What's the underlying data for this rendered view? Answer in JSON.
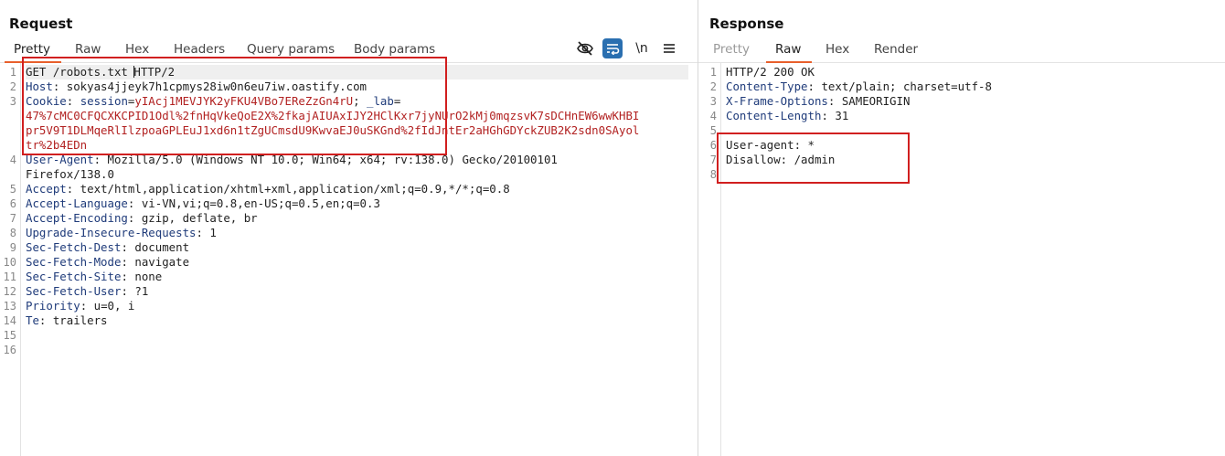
{
  "request": {
    "title": "Request",
    "tabs": [
      {
        "label": "Pretty",
        "active": true
      },
      {
        "label": "Raw"
      },
      {
        "label": "Hex"
      },
      {
        "label": "Headers"
      },
      {
        "label": "Query params"
      },
      {
        "label": "Body params"
      }
    ],
    "toolbar": {
      "icons": [
        "eye-slash-icon",
        "wrap-lines-icon",
        "newline-icon",
        "menu-icon"
      ],
      "newline_label": "\\n"
    },
    "line_numbers": [
      "1",
      "2",
      "3",
      "4",
      "5",
      "6",
      "7",
      "8",
      "9",
      "10",
      "11",
      "12",
      "13",
      "14",
      "15",
      "16"
    ],
    "lines": {
      "l1a": "GET /robots.txt ",
      "l1b": "HTTP/2",
      "l2_name": "Host",
      "l2_val": ": sokyas4jjeyk7h1cpmys28iw0n6eu7iw.oastify.com",
      "l3_name": "Cookie",
      "l3_sep": ": ",
      "l3_c1": "session",
      "l3_eq1": "=",
      "l3_v1": "yIAcj1MEVJYK2yFKU4VBo7EReZzGn4rU",
      "l3_sep2": "; ",
      "l3_c2": "_lab",
      "l3_eq2": "=",
      "l3_w1": "47%7cMC0CFQCXKCPID1Odl%2fnHqVkeQoE2X%2fkajAIUAxIJY2HClKxr7jyNUrO2kMj0mqzsvK7sDCHnEW6wwKHBI",
      "l3_w2": "pr5V9T1DLMqeRlIlzpoaGPLEuJ1xd6n1tZgUCmsdU9KwvaEJ0uSKGnd%2fIdJntEr2aHGhGDYckZUB2K2sdn0SAyol",
      "l3_w3": "tr%2b4EDn",
      "l4_name": "User-Agent",
      "l4_val": ": Mozilla/5.0 (Windows NT 10.0; Win64; x64; rv:138.0) Gecko/20100101",
      "l4_cont": "Firefox/138.0",
      "l5_name": "Accept",
      "l5_val": ": text/html,application/xhtml+xml,application/xml;q=0.9,*/*;q=0.8",
      "l6_name": "Accept-Language",
      "l6_val": ": vi-VN,vi;q=0.8,en-US;q=0.5,en;q=0.3",
      "l7_name": "Accept-Encoding",
      "l7_val": ": gzip, deflate, br",
      "l8_name": "Upgrade-Insecure-Requests",
      "l8_val": ": 1",
      "l9_name": "Sec-Fetch-Dest",
      "l9_val": ": document",
      "l10_name": "Sec-Fetch-Mode",
      "l10_val": ": navigate",
      "l11_name": "Sec-Fetch-Site",
      "l11_val": ": none",
      "l12_name": "Sec-Fetch-User",
      "l12_val": ": ?1",
      "l13_name": "Priority",
      "l13_val": ": u=0, i",
      "l14_name": "Te",
      "l14_val": ": trailers"
    }
  },
  "response": {
    "title": "Response",
    "tabs": [
      {
        "label": "Pretty",
        "disabled": true
      },
      {
        "label": "Raw",
        "active": true
      },
      {
        "label": "Hex"
      },
      {
        "label": "Render"
      }
    ],
    "line_numbers": [
      "1",
      "2",
      "3",
      "4",
      "5",
      "6",
      "7",
      "8"
    ],
    "lines": {
      "l1": "HTTP/2 200 OK",
      "l2_name": "Content-Type",
      "l2_val": ": text/plain; charset=utf-8",
      "l3_name": "X-Frame-Options",
      "l3_val": ": SAMEORIGIN",
      "l4_name": "Content-Length",
      "l4_val": ": 31",
      "l6": "User-agent: *",
      "l7": "Disallow: /admin"
    }
  },
  "colors": {
    "accent": "#e8602c",
    "highlight_box": "#d11f1f",
    "header_name": "#1f3b7a",
    "cookie_value": "#b22222",
    "tool_active": "#2a6fb0"
  }
}
